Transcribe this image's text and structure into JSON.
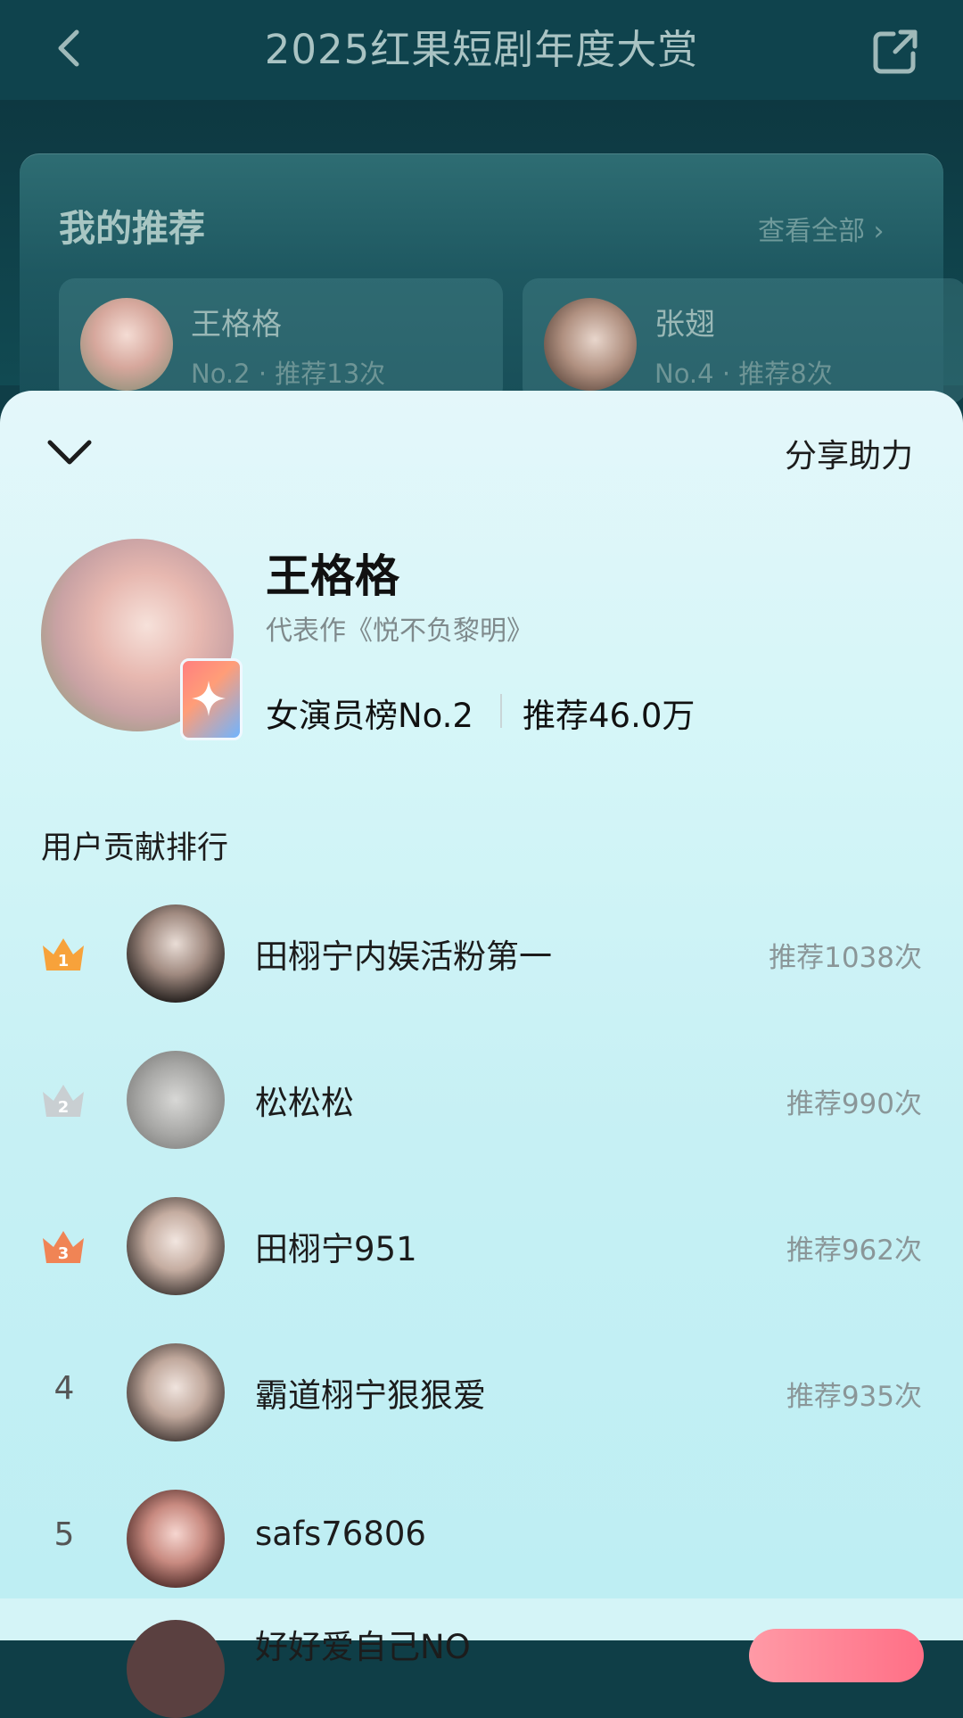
{
  "header": {
    "title": "2025红果短剧年度大赏"
  },
  "recommend": {
    "title": "我的推荐",
    "view_all": "查看全部 ›",
    "items": [
      {
        "name": "王格格",
        "meta": "No.2 · 推荐13次"
      },
      {
        "name": "张翅",
        "meta": "No.4 · 推荐8次"
      }
    ]
  },
  "sheet": {
    "share_label": "分享助力",
    "celeb": {
      "name": "王格格",
      "work": "代表作《悦不负黎明》",
      "rank": "女演员榜No.2",
      "votes": "推荐46.0万"
    },
    "contrib_title": "用户贡献排行",
    "rows": [
      {
        "rank": "1",
        "name": "田栩宁内娱活粉第一",
        "count": "推荐1038次"
      },
      {
        "rank": "2",
        "name": "松松松",
        "count": "推荐990次"
      },
      {
        "rank": "3",
        "name": "田栩宁951",
        "count": "推荐962次"
      },
      {
        "rank": "4",
        "name": "霸道栩宁狠狠爱",
        "count": "推荐935次"
      },
      {
        "rank": "5",
        "name": "safs76806",
        "count": ""
      }
    ],
    "cut_row_name": "好好爱自己NO"
  },
  "colors": {
    "gold": "#f7a23b",
    "silver": "#c9cfd2",
    "bronze": "#f08455"
  }
}
